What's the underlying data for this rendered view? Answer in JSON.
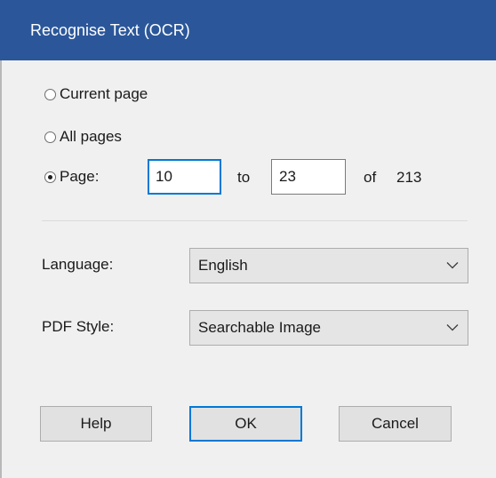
{
  "dialog": {
    "title": "Recognise Text (OCR)"
  },
  "page_range": {
    "options": [
      {
        "label": "Current page",
        "checked": false
      },
      {
        "label": "All pages",
        "checked": false
      },
      {
        "label": "Page:",
        "checked": true
      }
    ],
    "from_value": "10",
    "to_label": "to",
    "to_value": "23",
    "of_label": "of",
    "total_pages": "213"
  },
  "language": {
    "label": "Language:",
    "selected": "English"
  },
  "pdf_style": {
    "label": "PDF Style:",
    "selected": "Searchable Image"
  },
  "buttons": {
    "help": "Help",
    "ok": "OK",
    "cancel": "Cancel"
  },
  "colors": {
    "title_bar": "#2b579a",
    "focus_accent": "#0078d7",
    "dialog_background": "#f0f0f0"
  },
  "icons": {
    "dropdown": "chevron-down-icon"
  }
}
